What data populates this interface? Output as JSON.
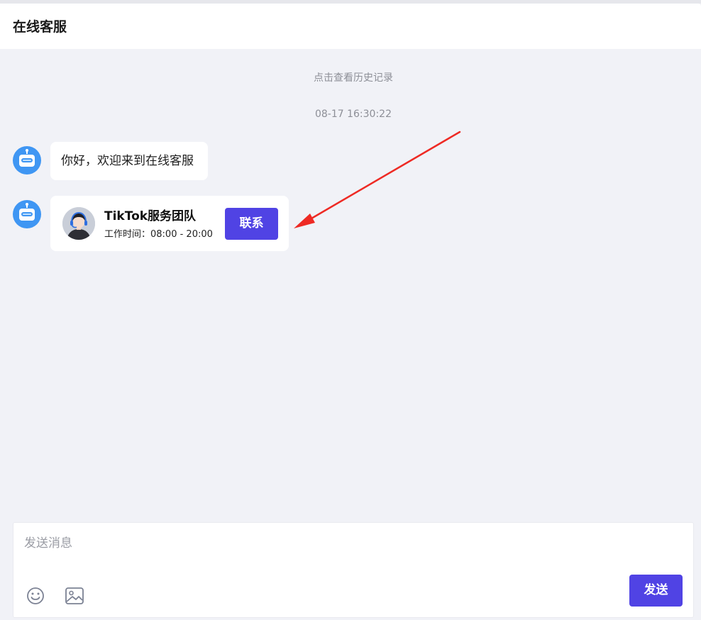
{
  "header": {
    "title": "在线客服"
  },
  "chat": {
    "history_link": "点击查看历史记录",
    "timestamp": "08-17 16:30:22",
    "messages": [
      {
        "sender": "bot",
        "text": "你好，欢迎来到在线客服"
      },
      {
        "sender": "bot",
        "card": {
          "team_name": "TikTok服务团队",
          "hours": "工作时间：08:00 - 20:00",
          "button_label": "联系"
        }
      }
    ]
  },
  "composer": {
    "placeholder": "发送消息",
    "send_label": "发送",
    "tools": [
      "emoji-icon",
      "image-icon"
    ]
  },
  "colors": {
    "accent": "#5043e4",
    "bot_avatar": "#3f96f3",
    "background": "#f1f2f7",
    "annotation_arrow": "#ee2a24"
  }
}
